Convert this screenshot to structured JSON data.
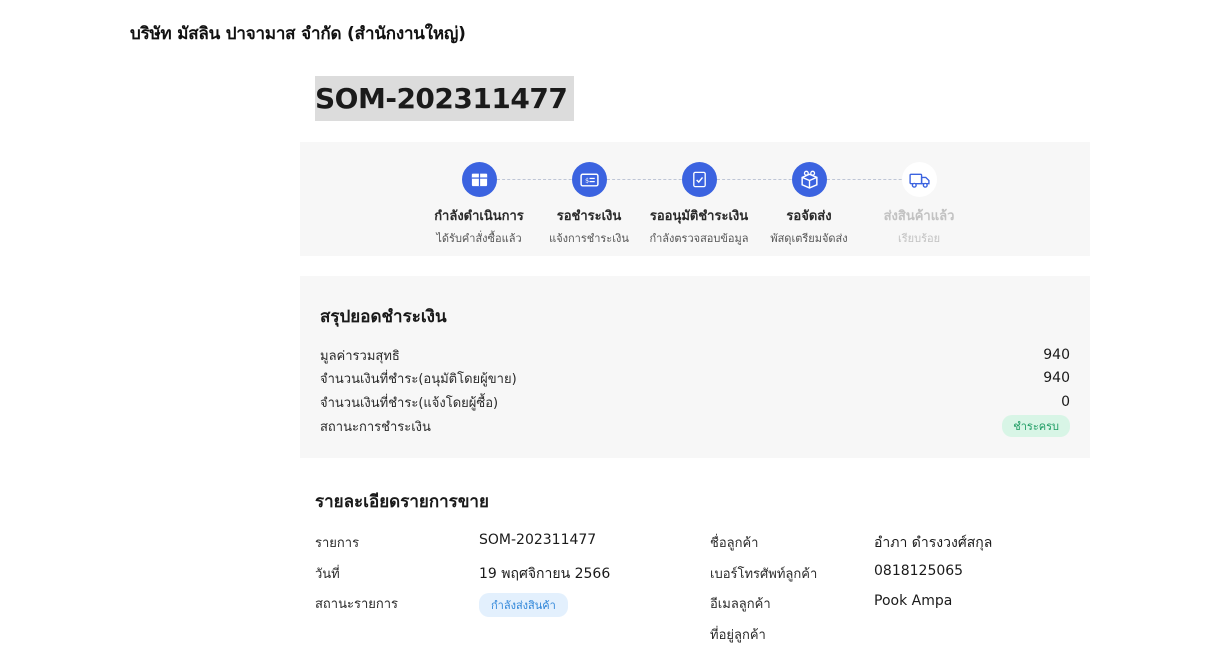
{
  "company_name": "บริษัท มัสลิน ปาจามาส จำกัด (สำนักงานใหญ่)",
  "order_id": "SOM-202311477",
  "accent_color": "#3b63e0",
  "steps": [
    {
      "title": "กำลังดำเนินการ",
      "subtitle": "ได้รับคำสั่งซื้อแล้ว",
      "icon": "box-icon",
      "active": true
    },
    {
      "title": "รอชำระเงิน",
      "subtitle": "แจ้งการชำระเงิน",
      "icon": "payment-card-icon",
      "active": true
    },
    {
      "title": "รออนุมัติชำระเงิน",
      "subtitle": "กำลังตรวจสอบข้อมูล",
      "icon": "document-check-icon",
      "active": true
    },
    {
      "title": "รอจัดส่ง",
      "subtitle": "พัสดุเตรียมจัดส่ง",
      "icon": "packages-icon",
      "active": true
    },
    {
      "title": "ส่งสินค้าแล้ว",
      "subtitle": "เรียบร้อย",
      "icon": "truck-icon",
      "active": false
    }
  ],
  "summary": {
    "title": "สรุปยอดชำระเงิน",
    "rows": [
      {
        "label": "มูลค่ารวมสุทธิ",
        "value": "940"
      },
      {
        "label": "จำนวนเงินที่ชำระ(อนุมัติโดยผู้ขาย)",
        "value": "940"
      },
      {
        "label": "จำนวนเงินที่ชำระ(แจ้งโดยผู้ซื้อ)",
        "value": "0"
      }
    ],
    "status_label": "สถานะการชำระเงิน",
    "status_badge": "ชำระครบ"
  },
  "details": {
    "title": "รายละเอียดรายการขาย",
    "item_label": "รายการ",
    "item_value": "SOM-202311477",
    "date_label": "วันที่",
    "date_value": "19 พฤศจิกายน 2566",
    "status_label": "สถานะรายการ",
    "status_badge": "กำลังส่งสินค้า",
    "customer_name_label": "ชื่อลูกค้า",
    "customer_name_value": "อำภา ดำรงวงศ์สกุล",
    "customer_phone_label": "เบอร์โทรศัพท์ลูกค้า",
    "customer_phone_value": "0818125065",
    "customer_email_label": "อีเมลลูกค้า",
    "customer_email_value": "Pook Ampa",
    "customer_address_label": "ที่อยู่ลูกค้า"
  }
}
